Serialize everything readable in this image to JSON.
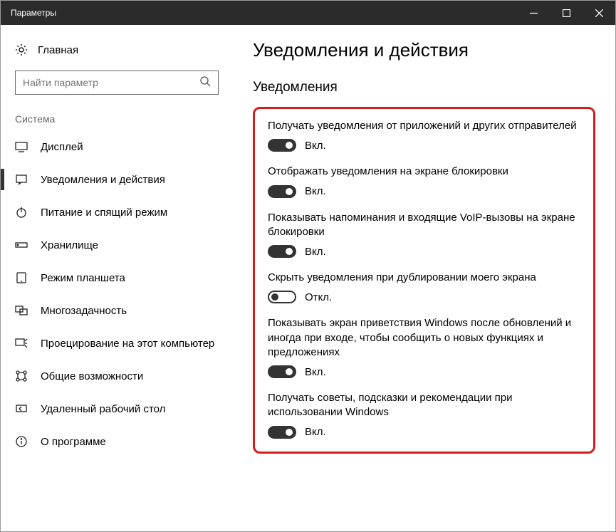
{
  "window": {
    "title": "Параметры"
  },
  "home": {
    "label": "Главная"
  },
  "search": {
    "placeholder": "Найти параметр"
  },
  "section_label": "Система",
  "nav": [
    {
      "label": "Дисплей"
    },
    {
      "label": "Уведомления и действия"
    },
    {
      "label": "Питание и спящий режим"
    },
    {
      "label": "Хранилище"
    },
    {
      "label": "Режим планшета"
    },
    {
      "label": "Многозадачность"
    },
    {
      "label": "Проецирование на этот компьютер"
    },
    {
      "label": "Общие возможности"
    },
    {
      "label": "Удаленный рабочий стол"
    },
    {
      "label": "О программе"
    }
  ],
  "page": {
    "title": "Уведомления и действия",
    "section": "Уведомления"
  },
  "labels": {
    "on": "Вкл.",
    "off": "Откл."
  },
  "settings": [
    {
      "desc": "Получать уведомления от приложений и других отправителей",
      "on": true
    },
    {
      "desc": "Отображать уведомления на экране блокировки",
      "on": true
    },
    {
      "desc": "Показывать напоминания и входящие VoIP-вызовы на экране блокировки",
      "on": true
    },
    {
      "desc": "Скрыть уведомления при дублировании моего экрана",
      "on": false
    },
    {
      "desc": "Показывать экран приветствия Windows после обновлений и иногда при входе, чтобы сообщить о новых функциях и предложениях",
      "on": true
    },
    {
      "desc": "Получать советы, подсказки и рекомендации при использовании Windows",
      "on": true
    }
  ]
}
